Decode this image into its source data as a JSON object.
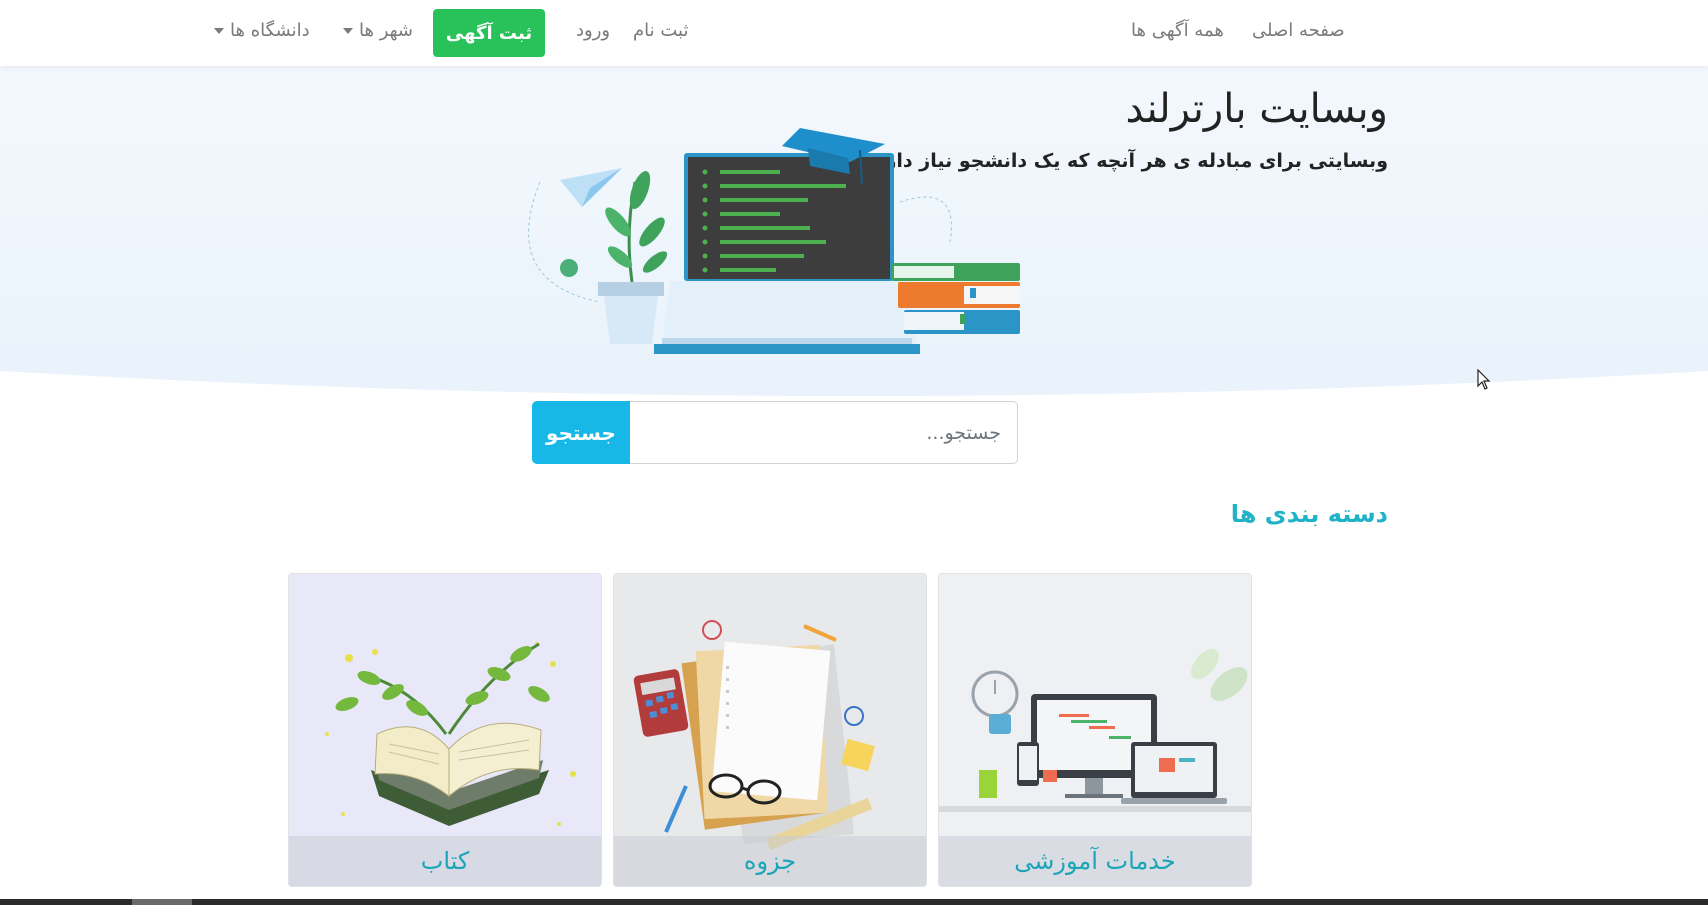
{
  "nav": {
    "home": "صفحه اصلی",
    "all_ads": "همه آگهی ها",
    "signup": "ثبت نام",
    "login": "ورود",
    "post_ad": "ثبت آگهی",
    "cities": "شهر ها",
    "universities": "دانشگاه ها"
  },
  "hero": {
    "title": "وبسایت بارترلند",
    "subtitle": "وبسایتی برای مبادله ی هر آنچه که یک دانشجو نیاز دارد"
  },
  "search": {
    "placeholder": "جستجو...",
    "button": "جستجو"
  },
  "categories": {
    "title": "دسته بندی ها",
    "items": [
      {
        "label": "خدمات آموزشی",
        "icon": "devices-illustration"
      },
      {
        "label": "جزوه",
        "icon": "notes-illustration"
      },
      {
        "label": "کتاب",
        "icon": "book-illustration"
      }
    ]
  },
  "colors": {
    "accent": "#20b3c8",
    "green": "#28c15a",
    "search_button": "#17b8e8"
  }
}
